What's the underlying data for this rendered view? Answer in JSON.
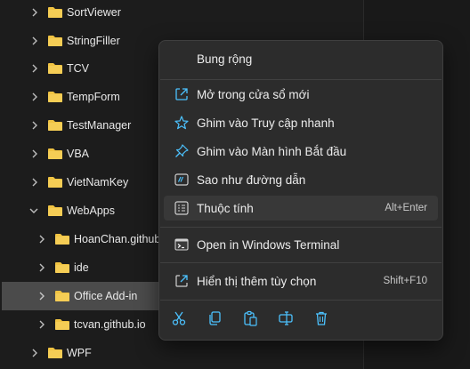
{
  "tree": {
    "items": [
      {
        "label": "SortViewer"
      },
      {
        "label": "StringFiller"
      },
      {
        "label": "TCV"
      },
      {
        "label": "TempForm"
      },
      {
        "label": "TestManager"
      },
      {
        "label": "VBA"
      },
      {
        "label": "VietNamKey"
      },
      {
        "label": "WebApps"
      },
      {
        "label": "HoanChan.github.io"
      },
      {
        "label": "ide"
      },
      {
        "label": "Office Add-in"
      },
      {
        "label": "tcvan.github.io"
      },
      {
        "label": "WPF"
      }
    ]
  },
  "context_menu": {
    "expand": "Bung rộng",
    "open_new_window": "Mở trong cửa sổ mới",
    "pin_quick_access": "Ghim vào Truy cập nhanh",
    "pin_start": "Ghim vào Màn hình Bắt đầu",
    "copy_as_path": "Sao như đường dẫn",
    "properties": "Thuộc tính",
    "properties_shortcut": "Alt+Enter",
    "open_terminal": "Open in Windows Terminal",
    "show_more": "Hiển thị thêm tùy chọn",
    "show_more_shortcut": "Shift+F10"
  },
  "colors": {
    "accent": "#4cc2ff",
    "folder": "#f0c342"
  }
}
